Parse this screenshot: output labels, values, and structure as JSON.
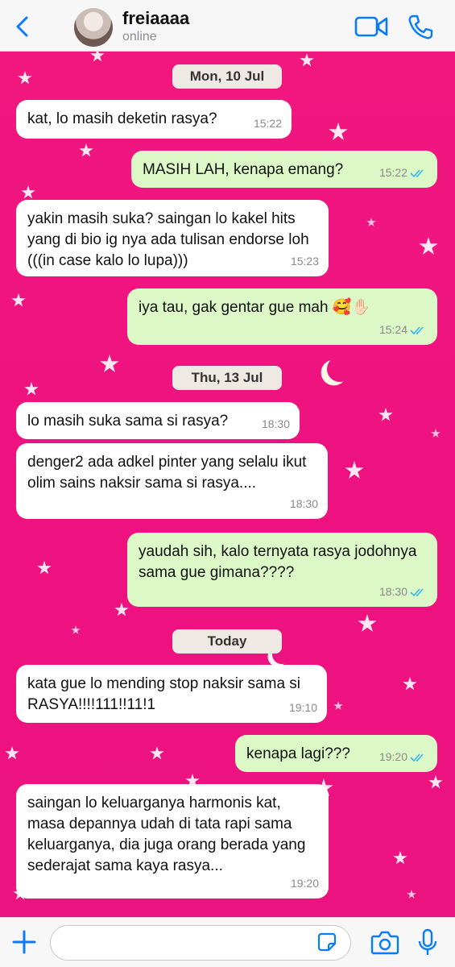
{
  "header": {
    "contact_name": "freiaaaa",
    "status": "online"
  },
  "colors": {
    "accent": "#0a7aff",
    "wallpaper": "#ee1280",
    "incoming_bubble": "#ffffff",
    "outgoing_bubble": "#dcf8c6",
    "read_ticks": "#34b7f1"
  },
  "dates": {
    "d1": "Mon, 10 Jul",
    "d2": "Thu, 13 Jul",
    "d3": "Today"
  },
  "messages": [
    {
      "dir": "in",
      "text": "kat, lo masih deketin rasya?",
      "time": "15:22"
    },
    {
      "dir": "out",
      "text": "MASIH LAH, kenapa emang?",
      "time": "15:22"
    },
    {
      "dir": "in",
      "text": "yakin masih suka? saingan lo kakel hits yang di bio ig nya ada tulisan endorse loh (((in case kalo lo lupa)))",
      "time": "15:23"
    },
    {
      "dir": "out",
      "text": "iya tau, gak gentar gue mah 🥰✋🏻",
      "time": "15:24"
    },
    {
      "dir": "in",
      "text": "lo masih suka sama si rasya?",
      "time": "18:30"
    },
    {
      "dir": "in",
      "text": "denger2 ada adkel pinter yang selalu ikut olim sains naksir sama si rasya....",
      "time": "18:30"
    },
    {
      "dir": "out",
      "text": "yaudah sih, kalo ternyata rasya jodohnya sama gue gimana????",
      "time": "18:30"
    },
    {
      "dir": "in",
      "text": "kata gue lo mending stop naksir sama si RASYA!!!!111!!11!1",
      "time": "19:10"
    },
    {
      "dir": "out",
      "text": "kenapa lagi???",
      "time": "19:20"
    },
    {
      "dir": "in",
      "text": "saingan lo keluarganya harmonis kat, masa depannya udah di tata rapi sama keluarganya, dia juga orang berada yang sederajat sama kaya rasya...",
      "time": "19:20"
    }
  ],
  "composer": {
    "placeholder": "",
    "value": ""
  },
  "icons": {
    "back": "chevron-left-icon",
    "video": "video-camera-icon",
    "call": "phone-icon",
    "attach": "plus-icon",
    "sticker": "sticker-icon",
    "camera": "camera-icon",
    "mic": "microphone-icon"
  }
}
